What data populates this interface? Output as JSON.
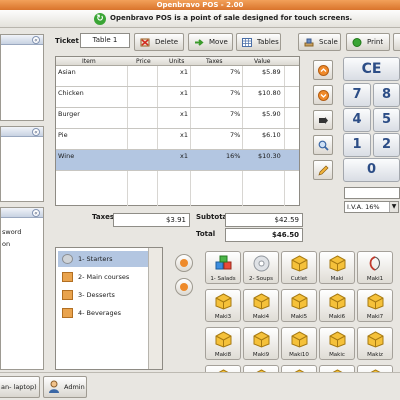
{
  "window": {
    "title": "Openbravo POS - 2.00"
  },
  "banner": {
    "message": "Openbravo POS is a point of sale designed for touch screens."
  },
  "left_panel": {
    "section2_items": [
      ""
    ],
    "section3_items": [
      "sword",
      "on"
    ]
  },
  "ticket": {
    "label": "Ticket",
    "value": "Table 1"
  },
  "toolbar": {
    "delete": "Delete",
    "move": "Move",
    "tables": "Tables",
    "scale": "Scale",
    "print": "Print"
  },
  "table": {
    "headers": [
      "Item",
      "Price",
      "Units",
      "Taxes",
      "Value"
    ],
    "rows": [
      {
        "item": "Asian",
        "price": "",
        "units": "x1",
        "taxes": "7%",
        "value": "$5.89"
      },
      {
        "item": "Chicken",
        "price": "",
        "units": "x1",
        "taxes": "7%",
        "value": "$10.80"
      },
      {
        "item": "Burger",
        "price": "",
        "units": "x1",
        "taxes": "7%",
        "value": "$5.90"
      },
      {
        "item": "Pie",
        "price": "",
        "units": "x1",
        "taxes": "7%",
        "value": "$6.10"
      },
      {
        "item": "Wine",
        "price": "",
        "units": "x1",
        "taxes": "16%",
        "value": "$10.30"
      }
    ]
  },
  "totals": {
    "taxes_label": "Taxes",
    "taxes_value": "$3.91",
    "subtotal_label": "Subtotal",
    "subtotal_value": "$42.59",
    "total_label": "Total",
    "total_value": "$46.50"
  },
  "keypad": {
    "ce": "CE",
    "k7": "7",
    "k8": "8",
    "k4": "4",
    "k5": "5",
    "k1": "1",
    "k2": "2",
    "k0": "0"
  },
  "tax_select": {
    "value": "I.V.A. 16%"
  },
  "categories": [
    {
      "label": "1- Starters",
      "selected": true
    },
    {
      "label": "2- Main courses",
      "selected": false
    },
    {
      "label": "3- Desserts",
      "selected": false
    },
    {
      "label": "4- Beverages",
      "selected": false
    }
  ],
  "products": [
    [
      "1- Salads",
      "2- Soups",
      "Cutlet",
      "Maki",
      "Maki1"
    ],
    [
      "Maki3",
      "Maki4",
      "Maki5",
      "Maki6",
      "Maki7"
    ],
    [
      "Maki8",
      "Maki9",
      "Maki10",
      "Makic",
      "Makiz"
    ],
    [
      "",
      "",
      "",
      "",
      ""
    ]
  ],
  "status": {
    "host": "an- laptop)",
    "user": "Admin"
  }
}
